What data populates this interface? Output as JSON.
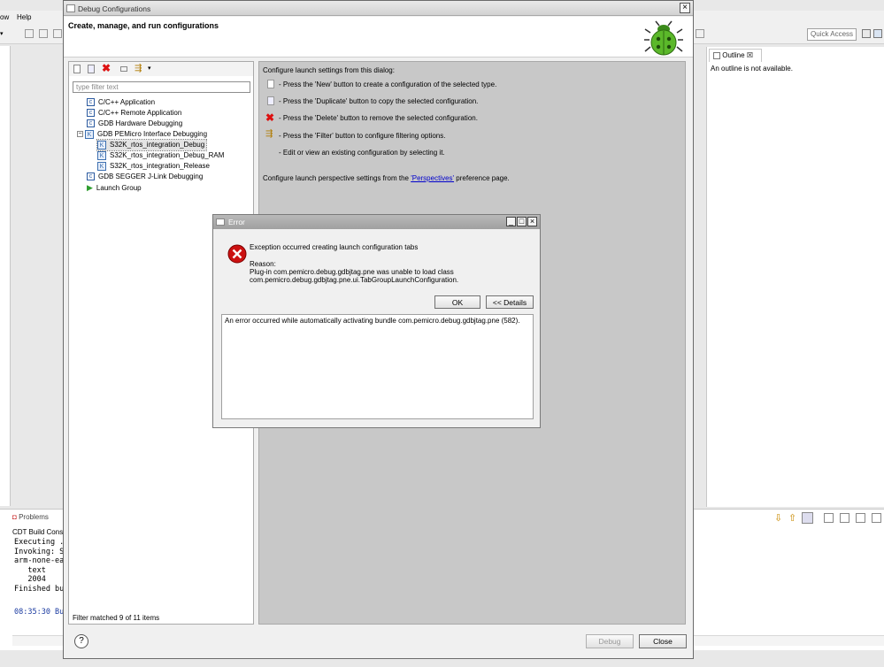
{
  "ide": {
    "menu_partial": [
      "ow",
      "Help"
    ],
    "quick_access_placeholder": "Quick Access",
    "outline_tab": "Outline",
    "outline_message": "An outline is not available.",
    "problems_tab": "Problems",
    "console_title": "CDT Build Conso",
    "console_lines": [
      "Executing ...",
      "Invoking: S",
      "arm-none-ea",
      "   text",
      "   2004",
      "Finished bu"
    ],
    "console_timestamp": "08:35:30 Bu"
  },
  "dialog": {
    "title": "Debug Configurations",
    "heading": "Create, manage, and run configurations",
    "filter_placeholder": "type filter text",
    "tree": [
      {
        "label": "C/C++ Application",
        "icon": "c-app-icon"
      },
      {
        "label": "C/C++ Remote Application",
        "icon": "c-remote-icon"
      },
      {
        "label": "GDB Hardware Debugging",
        "icon": "c-gdb-icon"
      },
      {
        "label": "GDB PEMicro Interface Debugging",
        "icon": "pemicro-icon",
        "expanded": true
      },
      {
        "label": "S32K_rtos_integration_Debug",
        "icon": "config-icon",
        "selected": true
      },
      {
        "label": "S32K_rtos_integration_Debug_RAM",
        "icon": "config-icon"
      },
      {
        "label": "S32K_rtos_integration_Release",
        "icon": "config-icon"
      },
      {
        "label": "GDB SEGGER J-Link Debugging",
        "icon": "c-segger-icon"
      },
      {
        "label": "Launch Group",
        "icon": "launch-group-icon"
      }
    ],
    "filter_status": "Filter matched 9 of 11 items",
    "info": {
      "intro": "Configure launch settings from this dialog:",
      "new": "- Press the 'New' button to create a configuration of the selected type.",
      "duplicate": "- Press the 'Duplicate' button to copy the selected configuration.",
      "delete": "- Press the 'Delete' button to remove the selected configuration.",
      "filter": "- Press the 'Filter' button to configure filtering options.",
      "edit": "- Edit or view an existing configuration by selecting it.",
      "perspective_prefix": "Configure launch perspective settings from the ",
      "perspective_link": "'Perspectives'",
      "perspective_suffix": " preference page."
    },
    "debug_button": "Debug",
    "close_button": "Close"
  },
  "error": {
    "title": "Error",
    "message": "Exception occurred creating launch configuration tabs",
    "reason_label": "Reason:",
    "reason_line1": "Plug-in com.pemicro.debug.gdbjtag.pne was unable to load class",
    "reason_line2": "com.pemicro.debug.gdbjtag.pne.ui.TabGroupLaunchConfiguration.",
    "ok_button": "OK",
    "details_button": "<< Details",
    "details_text": "An error occurred while automatically activating bundle com.pemicro.debug.gdbjtag.pne (582)."
  },
  "colors": {
    "accent": "#3c6fb0",
    "error_red": "#cc1111",
    "link": "#0000cc"
  }
}
